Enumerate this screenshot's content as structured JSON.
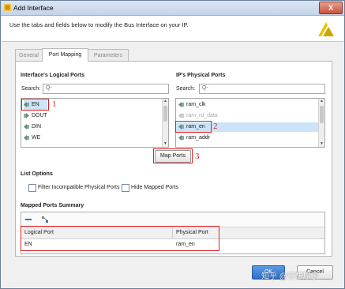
{
  "window": {
    "title": "Add Interface",
    "close_label": "X"
  },
  "header": {
    "description": "Use the tabs and fields below to modify the Bus Interface on your IP."
  },
  "tabs": [
    {
      "label": "General"
    },
    {
      "label": "Port Mapping"
    },
    {
      "label": "Parameters"
    }
  ],
  "logical": {
    "heading": "Interface's Logical Ports",
    "search_label": "Search:",
    "search_placeholder": "Q-",
    "items": [
      {
        "label": "EN",
        "selected": true
      },
      {
        "label": "DOUT",
        "selected": false
      },
      {
        "label": "DIN",
        "selected": false
      },
      {
        "label": "WE",
        "selected": false
      }
    ]
  },
  "physical": {
    "heading": "IP's Physical Ports",
    "search_label": "Search:",
    "search_placeholder": "Q-",
    "items": [
      {
        "label": "ram_clk",
        "state": "normal"
      },
      {
        "label": "ram_rd_data",
        "state": "dim"
      },
      {
        "label": "ram_en",
        "state": "selected"
      },
      {
        "label": "ram_addr",
        "state": "normal"
      }
    ]
  },
  "annotations": {
    "one": "1",
    "two": "2",
    "three": "3"
  },
  "map_ports_label": "Map Ports",
  "list_options": {
    "heading": "List Options",
    "filter_label": "Filter Incompatible Physical Ports",
    "hide_label": "Hide Mapped Ports"
  },
  "summary": {
    "heading": "Mapped Ports Summary",
    "columns": [
      "Logical Port",
      "Physical Port"
    ],
    "rows": [
      [
        "EN",
        "ram_en"
      ]
    ]
  },
  "footer": {
    "ok_label": "OK",
    "cancel_label": "Cancel"
  },
  "watermark": "知乎 @空想原子",
  "colors": {
    "accent": "#e02020",
    "selection": "#cde3f8",
    "ok_button": "#3a7bd5"
  }
}
